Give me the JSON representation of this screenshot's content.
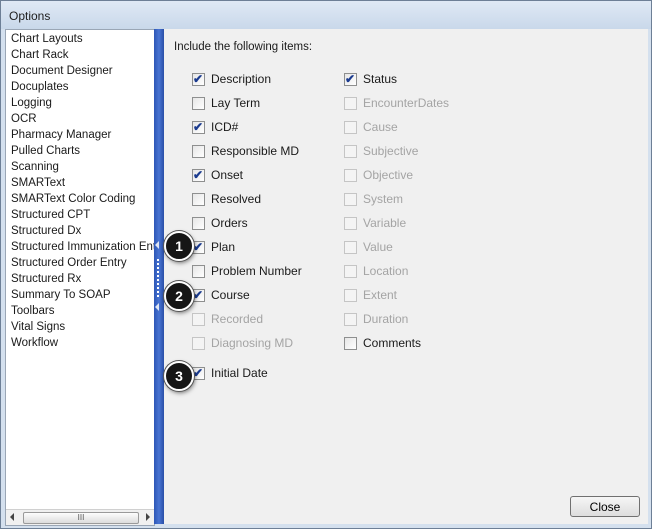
{
  "window": {
    "title": "Options"
  },
  "sidebar": {
    "items": [
      "Chart Layouts",
      "Chart Rack",
      "Document Designer",
      "Docuplates",
      "Logging",
      "OCR",
      "Pharmacy Manager",
      "Pulled Charts",
      "Scanning",
      "SMARText",
      "SMARText Color Coding",
      "Structured CPT",
      "Structured Dx",
      "Structured Immunization Entry",
      "Structured Order Entry",
      "Structured Rx",
      "Summary To SOAP",
      "Toolbars",
      "Vital Signs",
      "Workflow"
    ],
    "scroll_thumb": "III"
  },
  "panel": {
    "heading": "Include the following items:",
    "left_items": [
      {
        "label": "Description",
        "checked": true,
        "enabled": true
      },
      {
        "label": "Lay Term",
        "checked": false,
        "enabled": true
      },
      {
        "label": "ICD#",
        "checked": true,
        "enabled": true
      },
      {
        "label": "Responsible MD",
        "checked": false,
        "enabled": true
      },
      {
        "label": "Onset",
        "checked": true,
        "enabled": true
      },
      {
        "label": "Resolved",
        "checked": false,
        "enabled": true
      },
      {
        "label": "Orders",
        "checked": false,
        "enabled": true
      },
      {
        "label": "Plan",
        "checked": true,
        "enabled": true
      },
      {
        "label": "Problem Number",
        "checked": false,
        "enabled": true
      },
      {
        "label": "Course",
        "checked": true,
        "enabled": true
      },
      {
        "label": "Recorded",
        "checked": false,
        "enabled": false
      },
      {
        "label": "Diagnosing MD",
        "checked": false,
        "enabled": false
      }
    ],
    "right_items": [
      {
        "label": "Status",
        "checked": true,
        "enabled": true
      },
      {
        "label": "EncounterDates",
        "checked": false,
        "enabled": false
      },
      {
        "label": "Cause",
        "checked": false,
        "enabled": false
      },
      {
        "label": "Subjective",
        "checked": false,
        "enabled": false
      },
      {
        "label": "Objective",
        "checked": false,
        "enabled": false
      },
      {
        "label": "System",
        "checked": false,
        "enabled": false
      },
      {
        "label": "Variable",
        "checked": false,
        "enabled": false
      },
      {
        "label": "Value",
        "checked": false,
        "enabled": false
      },
      {
        "label": "Location",
        "checked": false,
        "enabled": false
      },
      {
        "label": "Extent",
        "checked": false,
        "enabled": false
      },
      {
        "label": "Duration",
        "checked": false,
        "enabled": false
      },
      {
        "label": "Comments",
        "checked": false,
        "enabled": true
      }
    ],
    "extra_item": {
      "label": "Initial Date",
      "checked": true,
      "enabled": true
    },
    "close_label": "Close"
  },
  "callouts": [
    "1",
    "2",
    "3"
  ],
  "colors": {
    "splitter": "#3b63c4",
    "check": "#1b3b8f",
    "callout": "#161616"
  }
}
